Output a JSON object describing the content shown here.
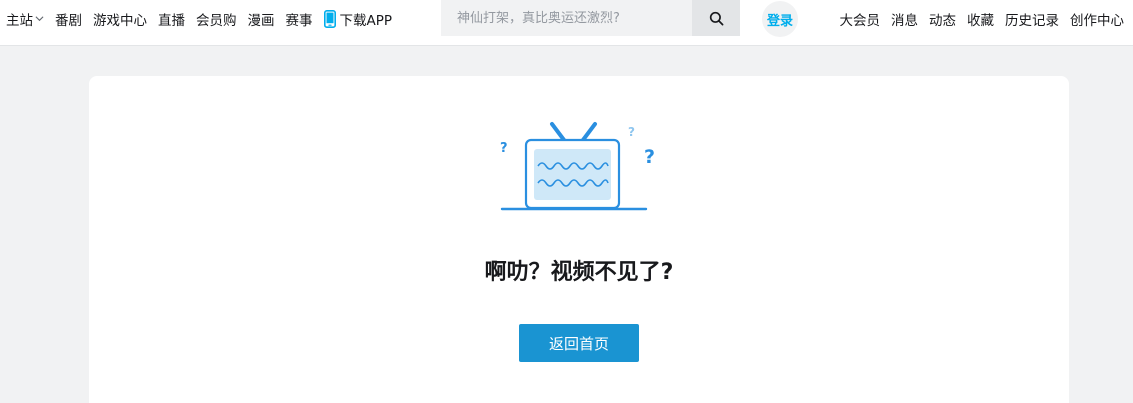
{
  "header": {
    "nav_left": [
      {
        "label": "主站",
        "has_dropdown": true
      },
      {
        "label": "番剧"
      },
      {
        "label": "游戏中心"
      },
      {
        "label": "直播"
      },
      {
        "label": "会员购"
      },
      {
        "label": "漫画"
      },
      {
        "label": "赛事"
      }
    ],
    "download_label": "下载APP",
    "search": {
      "placeholder": "神仙打架，真比奥运还激烈?",
      "value": ""
    },
    "login_label": "登录",
    "nav_right": [
      {
        "label": "大会员"
      },
      {
        "label": "消息"
      },
      {
        "label": "动态"
      },
      {
        "label": "收藏"
      },
      {
        "label": "历史记录"
      },
      {
        "label": "创作中心"
      }
    ]
  },
  "main": {
    "error_title": "啊叻？视频不见了?",
    "home_button_label": "返回首页"
  },
  "colors": {
    "accent": "#00aeec",
    "button": "#1a94d2",
    "illustration": "#2a8fe0",
    "page_bg": "#f1f2f3"
  },
  "icons": [
    "chevron-down-icon",
    "phone-icon",
    "search-icon",
    "broken-tv-illustration"
  ]
}
